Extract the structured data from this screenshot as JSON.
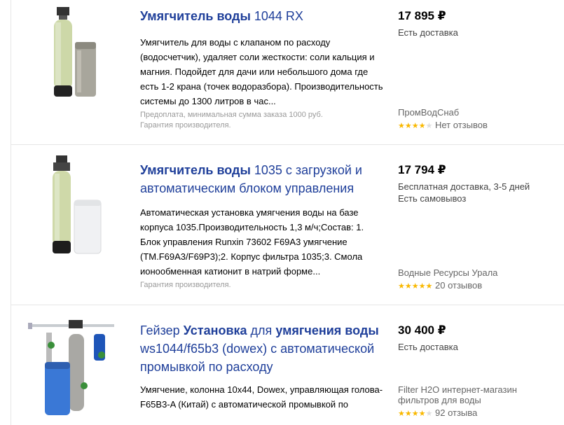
{
  "listings": [
    {
      "title_parts": [
        {
          "text": "Умягчитель воды",
          "bold": true
        },
        {
          "text": " 1044 RX",
          "bold": false
        }
      ],
      "description": "Умягчитель для воды с клапаном по расходу (водосчетчик), удаляет соли жесткости: соли кальция и магния. Подойдет для дачи или небольшого дома где есть 1-2 крана (точек водоразбора). Производительность системы до 1300 литров в час...",
      "notes": [
        "Предоплата, минимальная сумма заказа 1000 руб.",
        "Гарантия производителя."
      ],
      "price": "17 895 ₽",
      "delivery": [
        "Есть доставка"
      ],
      "shop": "ПромВодСнаб",
      "stars": 4,
      "reviews": "Нет отзывов"
    },
    {
      "title_parts": [
        {
          "text": "Умягчитель воды",
          "bold": true
        },
        {
          "text": " 1035 с загрузкой и автоматическим блоком управления",
          "bold": false
        }
      ],
      "description": "Автоматическая установка умягчения воды на базе корпуса 1035.Производительность 1,3 м/ч;Состав: 1. Блок управления Runxin 73602 F69A3 умягчение (TM.F69A3/F69P3);2. Корпус фильтра 1035;3. Смола ионообменная катионит в натрий форме...",
      "notes": [
        "Гарантия производителя."
      ],
      "price": "17 794 ₽",
      "delivery": [
        "Бесплатная доставка, 3-5 дней",
        "Есть самовывоз"
      ],
      "shop": "Водные Ресурсы Урала",
      "stars": 5,
      "reviews": "20 отзывов"
    },
    {
      "title_parts": [
        {
          "text": "Гейзер ",
          "bold": false
        },
        {
          "text": "Установка",
          "bold": true
        },
        {
          "text": " для ",
          "bold": false
        },
        {
          "text": "умягчения воды",
          "bold": true
        },
        {
          "text": " ws1044/f65b3 (dowex) с автоматической промывкой по расходу",
          "bold": false
        }
      ],
      "description": "Умягчение, колонна 10x44, Dowex, управляющая голова-F65B3-A (Китай) с автоматической промывкой по",
      "notes": [],
      "price": "30 400 ₽",
      "delivery": [
        "Есть доставка"
      ],
      "shop": "Filter H2O интернет-магазин фильтров для воды",
      "stars": 4,
      "reviews": "92 отзыва"
    }
  ],
  "colors": {
    "title": "#1f3f9a",
    "star": "#f9b800",
    "star_off": "#dddddd",
    "separator": "#e6e6e6"
  },
  "icons": [
    "star-icon",
    "water-softener-image",
    "filter-system-image"
  ]
}
